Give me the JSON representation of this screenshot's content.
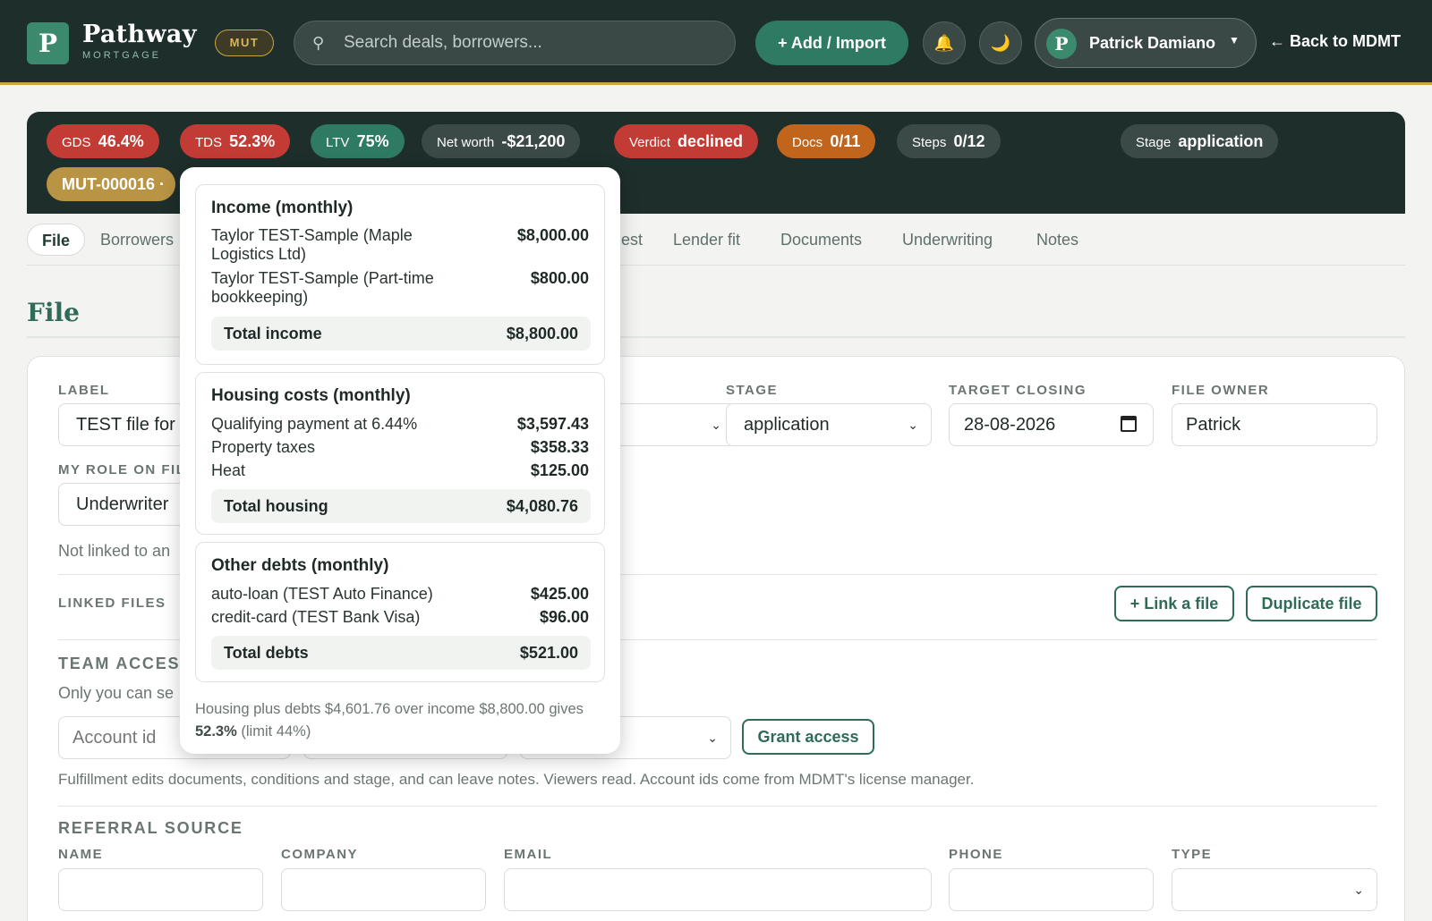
{
  "header": {
    "logo_letter": "P",
    "brand": "Pathway",
    "brand_sub": "MORTGAGE",
    "badge": "MUT",
    "search_placeholder": "Search deals, borrowers...",
    "add_button": "+ Add / Import",
    "bell_icon": "🔔",
    "moon_icon": "🌙",
    "user_initial": "P",
    "user_name": "Patrick Damiano",
    "back_link": "← Back to MDMT"
  },
  "status": {
    "gds": {
      "label": "GDS",
      "value": "46.4%"
    },
    "tds": {
      "label": "TDS",
      "value": "52.3%"
    },
    "ltv": {
      "label": "LTV",
      "value": "75%"
    },
    "net_worth": {
      "label": "Net worth",
      "value": "-$21,200"
    },
    "verdict": {
      "label": "Verdict",
      "value": "declined"
    },
    "docs": {
      "label": "Docs",
      "value": "0/11"
    },
    "steps": {
      "label": "Steps",
      "value": "0/12"
    },
    "stage": {
      "label": "Stage",
      "value": "application"
    },
    "file_id": "MUT-000016 ·"
  },
  "tabs": [
    "File",
    "Borrowers",
    "est",
    "Lender fit",
    "Documents",
    "Underwriting",
    "Notes"
  ],
  "page_title": "File",
  "form": {
    "label_label": "LABEL",
    "label_value": "TEST file for s",
    "stage_label": "STAGE",
    "stage_value": "application",
    "target_label": "TARGET CLOSING",
    "target_value": "28-08-2026",
    "owner_label": "FILE OWNER",
    "owner_value": "Patrick",
    "role_label": "MY ROLE ON FIL",
    "role_value": "Underwriter",
    "not_linked": "Not linked to an",
    "linked_label": "LINKED FILES",
    "link_button": "+ Link a file",
    "duplicate_button": "Duplicate file",
    "team_heading": "TEAM ACCESS",
    "team_note": "Only you can se",
    "account_placeholder": "Account id",
    "grant_button": "Grant access",
    "fulfillment_note": "Fulfillment edits documents, conditions and stage, and can leave notes. Viewers read. Account ids come from MDMT's license manager.",
    "referral_heading": "REFERRAL SOURCE",
    "ref_name": "NAME",
    "ref_company": "COMPANY",
    "ref_email": "EMAIL",
    "ref_phone": "PHONE",
    "ref_type": "TYPE"
  },
  "popover": {
    "income": {
      "title": "Income (monthly)",
      "rows": [
        {
          "label": "Taylor TEST-Sample (Maple Logistics Ltd)",
          "value": "$8,000.00"
        },
        {
          "label": "Taylor TEST-Sample (Part-time bookkeeping)",
          "value": "$800.00"
        }
      ],
      "total_label": "Total income",
      "total_value": "$8,800.00"
    },
    "housing": {
      "title": "Housing costs (monthly)",
      "rows": [
        {
          "label": "Qualifying payment at 6.44%",
          "value": "$3,597.43"
        },
        {
          "label": "Property taxes",
          "value": "$358.33"
        },
        {
          "label": "Heat",
          "value": "$125.00"
        }
      ],
      "total_label": "Total housing",
      "total_value": "$4,080.76"
    },
    "debts": {
      "title": "Other debts (monthly)",
      "rows": [
        {
          "label": "auto-loan (TEST Auto Finance)",
          "value": "$425.00"
        },
        {
          "label": "credit-card (TEST Bank Visa)",
          "value": "$96.00"
        }
      ],
      "total_label": "Total debts",
      "total_value": "$521.00"
    },
    "footer_pre": "Housing plus debts $4,601.76 over income $8,800.00 gives",
    "footer_bold": "52.3%",
    "footer_post": "(limit 44%)"
  }
}
